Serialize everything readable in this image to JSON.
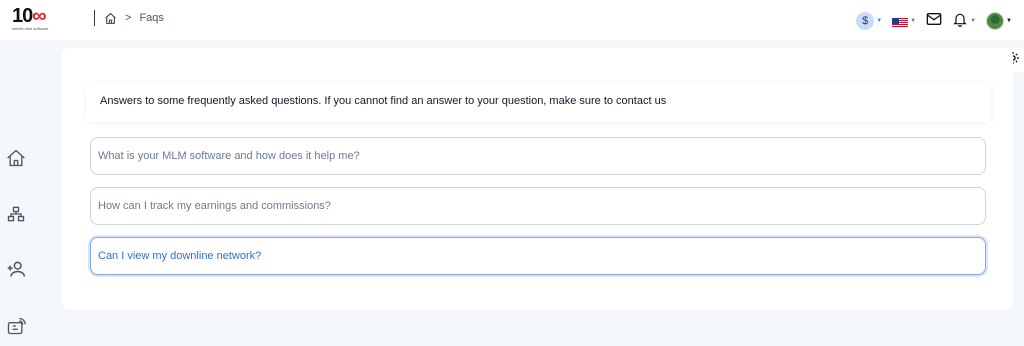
{
  "logo": {
    "text_main": "10",
    "text_accent": "∞",
    "tagline": "infinite mlm software"
  },
  "breadcrumb": {
    "home_icon": "home-icon",
    "separator": ">",
    "current": "Faqs"
  },
  "header_right": {
    "currency_symbol": "$",
    "language_flag": "us-flag-icon",
    "mail_icon": "mail-icon",
    "bell_icon": "bell-icon",
    "avatar": "user-avatar"
  },
  "sidebar": {
    "items": [
      {
        "icon": "home-icon"
      },
      {
        "icon": "network-tree-icon"
      },
      {
        "icon": "add-user-icon"
      },
      {
        "icon": "wallet-icon"
      }
    ]
  },
  "settings_icon": "gear-icon",
  "faq": {
    "intro": "Answers to some frequently asked questions. If you cannot find an answer to your question, make sure to contact us",
    "questions": [
      "What is your MLM software and how does it help me?",
      "How can I track my earnings and commissions?",
      "Can I view my downline network?"
    ],
    "active_index": 2
  },
  "colors": {
    "accent": "#2f6fd0",
    "brand_red": "#e11d2a",
    "page_bg": "#f4f7fb"
  }
}
